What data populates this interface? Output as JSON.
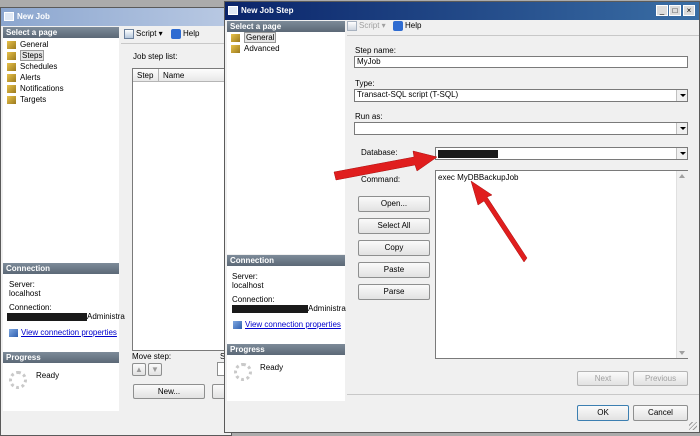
{
  "job_window": {
    "title": "New Job",
    "select_page_header": "Select a page",
    "pages": [
      "General",
      "Steps",
      "Schedules",
      "Alerts",
      "Notifications",
      "Targets"
    ],
    "toolbar": {
      "script": "Script",
      "help": "Help"
    },
    "job_step_list_label": "Job step list:",
    "columns": [
      "Step",
      "Name"
    ],
    "connection_header": "Connection",
    "server_label": "Server:",
    "server_value": "localhost",
    "connection_label": "Connection:",
    "connection_value_suffix": "Administra",
    "view_connection_link": "View connection properties",
    "progress_header": "Progress",
    "progress_status": "Ready",
    "move_step_label": "Move step:",
    "partial_label": "S",
    "new_button": "New..."
  },
  "step_window": {
    "title": "New Job Step",
    "select_page_header": "Select a page",
    "pages": [
      "General",
      "Advanced"
    ],
    "toolbar": {
      "script": "Script",
      "help": "Help"
    },
    "step_name_label": "Step name:",
    "step_name_value": "MyJob",
    "type_label": "Type:",
    "type_value": "Transact-SQL script (T-SQL)",
    "run_as_label": "Run as:",
    "run_as_value": "",
    "database_label": "Database:",
    "command_label": "Command:",
    "command_value": "exec MyDBBackupJob",
    "buttons": {
      "open": "Open...",
      "select_all": "Select All",
      "copy": "Copy",
      "paste": "Paste",
      "parse": "Parse"
    },
    "connection_header": "Connection",
    "server_label": "Server:",
    "server_value": "localhost",
    "connection_label": "Connection:",
    "connection_value_suffix": "Administra",
    "view_connection_link": "View connection properties",
    "progress_header": "Progress",
    "progress_status": "Ready",
    "next_button": "Next",
    "previous_button": "Previous",
    "ok_button": "OK",
    "cancel_button": "Cancel"
  },
  "colors": {
    "titlebar_active": "#0a246a",
    "titlebar_inactive": "#7a96c6",
    "annotation_arrow": "#e01e1e",
    "link": "#0000cc"
  }
}
